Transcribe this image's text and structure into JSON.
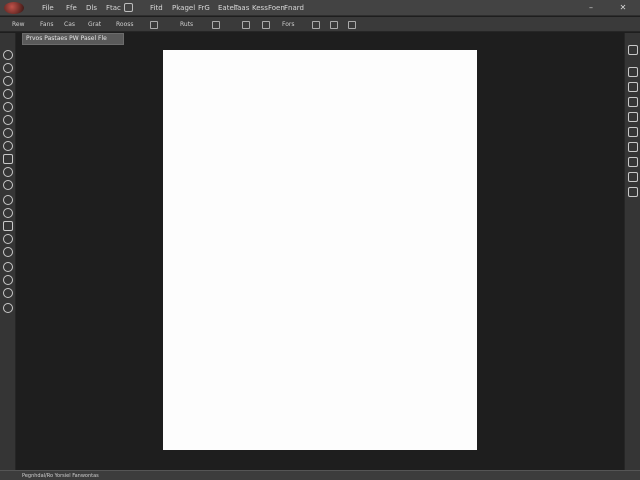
{
  "menubar": {
    "items": [
      "File",
      "Ffe",
      "Dls",
      "Ftac",
      "Fitd",
      "Pkagel",
      "FrG",
      "Eatei",
      "Taas",
      "Kess",
      "Foen",
      "Fnard"
    ],
    "minimize_label": "–",
    "close_label": "✕"
  },
  "options_bar": {
    "items": [
      "Rew",
      "Fans",
      "Cas",
      "Grat",
      "Rooss",
      "Ruts",
      "Fors"
    ]
  },
  "document": {
    "tab_label": "Prvos Pastaes PW Pasel Fle"
  },
  "status": {
    "text": "Pegnhdal/Ro Yorsiel Fanwontas"
  },
  "tools": {
    "left_count": 20,
    "right_count": 10
  },
  "colors": {
    "workspace": "#1e1e1e",
    "panel": "#353535",
    "menubar": "#434343",
    "artboard": "#fdfdfd"
  }
}
